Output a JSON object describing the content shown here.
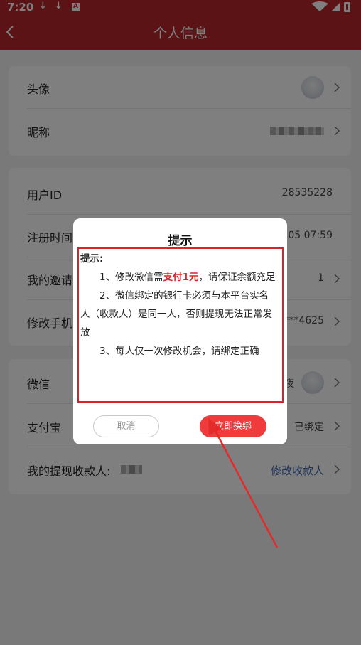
{
  "status_bar": {
    "time": "7:20",
    "download_icon": "↓",
    "a_icon": "A"
  },
  "header": {
    "title": "个人信息"
  },
  "profile": {
    "avatar_label": "头像",
    "nickname_label": "昵称"
  },
  "account": {
    "user_id_label": "用户ID",
    "user_id_value": "28535228",
    "register_label": "注册时间",
    "register_value": "05 07:59",
    "invite_label": "我的邀请",
    "invite_value": "1",
    "phone_label": "修改手机",
    "phone_value": "***4625"
  },
  "binding": {
    "wechat_label": "微信",
    "wechat_value": "夜",
    "alipay_label": "支付宝",
    "alipay_value": "已绑定",
    "payee_label": "我的提现收款人:",
    "payee_link": "修改收款人"
  },
  "dialog": {
    "title": "提示",
    "heading": "提示:",
    "item1_a": "1、修改微信需",
    "item1_highlight": "支付1元",
    "item1_b": "，请保证余额充足",
    "item2": "2、微信绑定的银行卡必须与本平台实名人（收款人）是同一人，否则提现无法正常发放",
    "item3": "3、每人仅一次修改机会，请绑定正确",
    "cancel": "取消",
    "confirm": "立即换绑"
  },
  "colors": {
    "brand": "#b6262a",
    "confirm": "#ef3b3b",
    "highlight": "#e0242a",
    "link": "#3b67b8",
    "annotation": "#e52a2a"
  },
  "icons": [
    "download-icon",
    "a-icon",
    "wifi-icon",
    "battery-icon",
    "back-arrow-icon",
    "chevron-right-icon"
  ]
}
